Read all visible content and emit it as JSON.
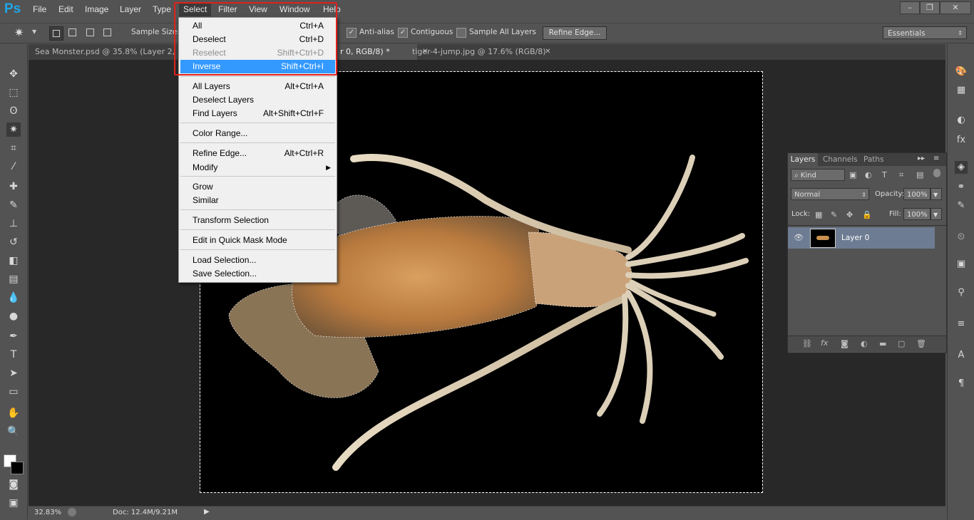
{
  "app": {
    "logo": "Ps"
  },
  "menubar": {
    "items": [
      {
        "label": "File"
      },
      {
        "label": "Edit"
      },
      {
        "label": "Image"
      },
      {
        "label": "Layer"
      },
      {
        "label": "Type"
      },
      {
        "label": "Select"
      },
      {
        "label": "Filter"
      },
      {
        "label": "View"
      },
      {
        "label": "Window"
      },
      {
        "label": "Help"
      }
    ]
  },
  "options": {
    "sample_size_label": "Sample Size:",
    "anti_alias": "Anti-alias",
    "contiguous": "Contiguous",
    "sample_all_layers": "Sample All Layers",
    "refine_edge": "Refine Edge...",
    "workspace": "Essentials"
  },
  "tabs": [
    {
      "label": "Sea Monster.psd @ 35.8% (Layer 2, RGB"
    },
    {
      "label": "r 0, RGB/8) *"
    },
    {
      "label": "tiger-4-jump.jpg @ 17.6% (RGB/8)"
    }
  ],
  "select_menu": {
    "items": [
      {
        "label": "All",
        "shortcut": "Ctrl+A",
        "enabled": true
      },
      {
        "label": "Deselect",
        "shortcut": "Ctrl+D",
        "enabled": true
      },
      {
        "label": "Reselect",
        "shortcut": "Shift+Ctrl+D",
        "enabled": false
      },
      {
        "label": "Inverse",
        "shortcut": "Shift+Ctrl+I",
        "enabled": true,
        "highlighted": true
      },
      {
        "label": "All Layers",
        "shortcut": "Alt+Ctrl+A",
        "enabled": true
      },
      {
        "label": "Deselect Layers",
        "shortcut": "",
        "enabled": true
      },
      {
        "label": "Find Layers",
        "shortcut": "Alt+Shift+Ctrl+F",
        "enabled": true
      },
      {
        "label": "Color Range...",
        "shortcut": "",
        "enabled": true
      },
      {
        "label": "Refine Edge...",
        "shortcut": "Alt+Ctrl+R",
        "enabled": true
      },
      {
        "label": "Modify",
        "shortcut": "",
        "enabled": true,
        "submenu": true
      },
      {
        "label": "Grow",
        "shortcut": "",
        "enabled": true
      },
      {
        "label": "Similar",
        "shortcut": "",
        "enabled": true
      },
      {
        "label": "Transform Selection",
        "shortcut": "",
        "enabled": true
      },
      {
        "label": "Edit in Quick Mask Mode",
        "shortcut": "",
        "enabled": true
      },
      {
        "label": "Load Selection...",
        "shortcut": "",
        "enabled": true
      },
      {
        "label": "Save Selection...",
        "shortcut": "",
        "enabled": true
      }
    ]
  },
  "layers_panel": {
    "tabs": [
      {
        "label": "Layers"
      },
      {
        "label": "Channels"
      },
      {
        "label": "Paths"
      }
    ],
    "filter": "Kind",
    "blend_mode": "Normal",
    "opacity_label": "Opacity:",
    "opacity": "100%",
    "lock_label": "Lock:",
    "fill_label": "Fill:",
    "fill": "100%",
    "layers": [
      {
        "name": "Layer 0"
      }
    ]
  },
  "status": {
    "zoom": "32.83%",
    "doc": "Doc: 12.4M/9.21M"
  },
  "colors": {
    "accent": "#3399ff",
    "highlight_box": "#e0201d",
    "logo": "#1fa6e8"
  }
}
